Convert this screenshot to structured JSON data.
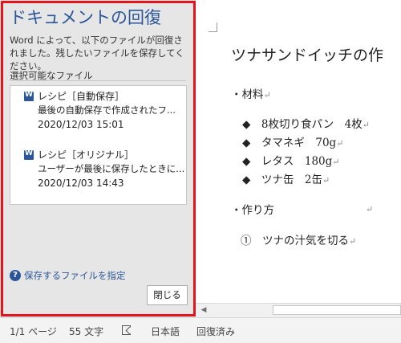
{
  "recovery": {
    "title": "ドキュメントの回復",
    "description": "Word によって、以下のファイルが回復されました。残したいファイルを保存してください。",
    "available_label": "選択可能なファイル",
    "files": [
      {
        "name": "レシピ［自動保存］",
        "desc": "最後の自動保存で作成されたフ...",
        "date": "2020/12/03 15:01"
      },
      {
        "name": "レシピ［オリジナル］",
        "desc": "ユーザーが最後に保存したときに...",
        "date": "2020/12/03 14:43"
      }
    ],
    "help_link": "保存するファイルを指定",
    "close_button": "閉じる"
  },
  "document": {
    "title": "ツナサンドイッチの作",
    "ingredients_heading": "・材料",
    "ingredients": [
      "◆　8枚切り食パン　4枚",
      "◆　タマネギ　70g",
      "◆　レタス　180g",
      "◆　ツナ缶　2缶"
    ],
    "steps_heading": "・作り方",
    "steps": [
      "①　ツナの汁気を切る"
    ]
  },
  "status": {
    "page": "1/1 ページ",
    "words": "55 文字",
    "language": "日本語",
    "recovery": "回復済み"
  },
  "colors": {
    "accent": "#2b579a",
    "highlight": "#e3141b"
  }
}
